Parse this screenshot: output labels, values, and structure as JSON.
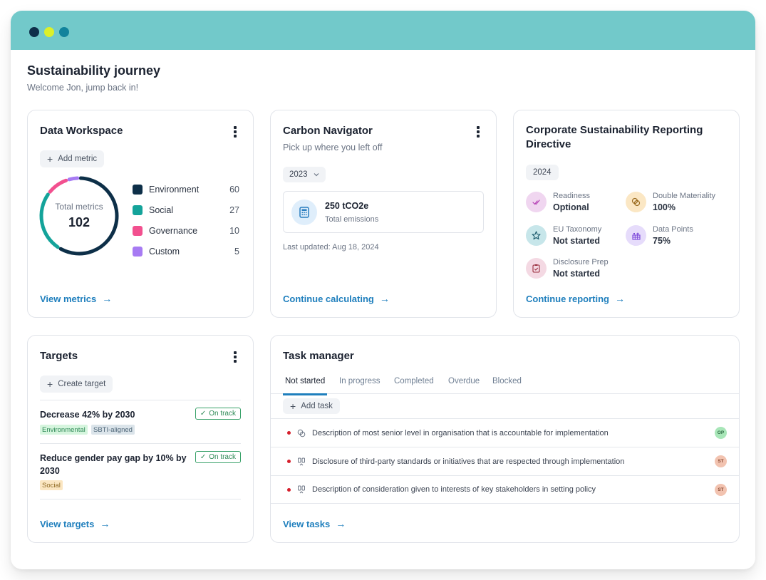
{
  "window": {
    "traffic_lights": [
      "#0e2f4a",
      "#dcf02a",
      "#12839c"
    ],
    "titlebar_color": "#72c9ca"
  },
  "header": {
    "title": "Sustainability journey",
    "subtitle": "Welcome Jon, jump back in!"
  },
  "data_workspace": {
    "title": "Data Workspace",
    "add_button": "Add metric",
    "total_label": "Total metrics",
    "total_value": "102",
    "categories": [
      {
        "name": "Environment",
        "value": 60,
        "color": "#0d2f48"
      },
      {
        "name": "Social",
        "value": 27,
        "color": "#14a39a"
      },
      {
        "name": "Governance",
        "value": 10,
        "color": "#f2508f"
      },
      {
        "name": "Custom",
        "value": 5,
        "color": "#a77bf3"
      }
    ],
    "link": "View metrics"
  },
  "carbon_navigator": {
    "title": "Carbon Navigator",
    "subtitle": "Pick up where you left off",
    "year": "2023",
    "emissions_value": "250 tCO2e",
    "emissions_label": "Total emissions",
    "last_updated": "Last updated: Aug 18, 2024",
    "link": "Continue calculating"
  },
  "csrd": {
    "title": "Corporate Sustainability Reporting Directive",
    "year": "2024",
    "stats": [
      {
        "icon": "double-check-icon",
        "label": "Readiness",
        "value": "Optional",
        "bg": "#f0d6f0",
        "fg": "#b53fb5"
      },
      {
        "icon": "linked-circles-icon",
        "label": "Double Materiality",
        "value": "100%",
        "bg": "#fbe7c4",
        "fg": "#9a6b1f"
      },
      {
        "icon": "star-icon",
        "label": "EU Taxonomy",
        "value": "Not started",
        "bg": "#c7e6ea",
        "fg": "#1e5c6e"
      },
      {
        "icon": "data-grid-icon",
        "label": "Data Points",
        "value": "75%",
        "bg": "#e6dcfb",
        "fg": "#7a45d9"
      },
      {
        "icon": "clipboard-icon",
        "label": "Disclosure Prep",
        "value": "Not started",
        "bg": "#f4d9e3",
        "fg": "#9a2f3e"
      }
    ],
    "link": "Continue reporting"
  },
  "targets": {
    "title": "Targets",
    "create_button": "Create target",
    "items": [
      {
        "title": "Decrease 42% by 2030",
        "status": "On track",
        "tags": [
          "Environmental",
          "SBTI-aligned"
        ]
      },
      {
        "title": "Reduce gender pay gap by 10% by 2030",
        "status": "On track",
        "tags": [
          "Social"
        ]
      }
    ],
    "link": "View targets"
  },
  "task_manager": {
    "title": "Task manager",
    "tabs": [
      "Not started",
      "In progress",
      "Completed",
      "Overdue",
      "Blocked"
    ],
    "active_tab": "Not started",
    "add_button": "Add task",
    "tasks": [
      {
        "text": "Description of most senior level in organisation that is accountable for implementation",
        "icon": "linked-circles-icon",
        "assignee": "OP",
        "avatar_bg": "#a8e6b8",
        "avatar_fg": "#2f6b45"
      },
      {
        "text": "Disclosure of third-party standards or initiatives that are respected through implementation",
        "icon": "people-icon",
        "assignee": "ST",
        "avatar_bg": "#f2c3b0",
        "avatar_fg": "#8a4a33"
      },
      {
        "text": "Description of consideration given to interests of key stakeholders in setting policy",
        "icon": "people-icon",
        "assignee": "ST",
        "avatar_bg": "#f2c3b0",
        "avatar_fg": "#8a4a33"
      }
    ],
    "link": "View tasks"
  },
  "icons": {
    "plus": "+",
    "arrow": "→",
    "check": "✓",
    "chevron_down": "⌄"
  }
}
